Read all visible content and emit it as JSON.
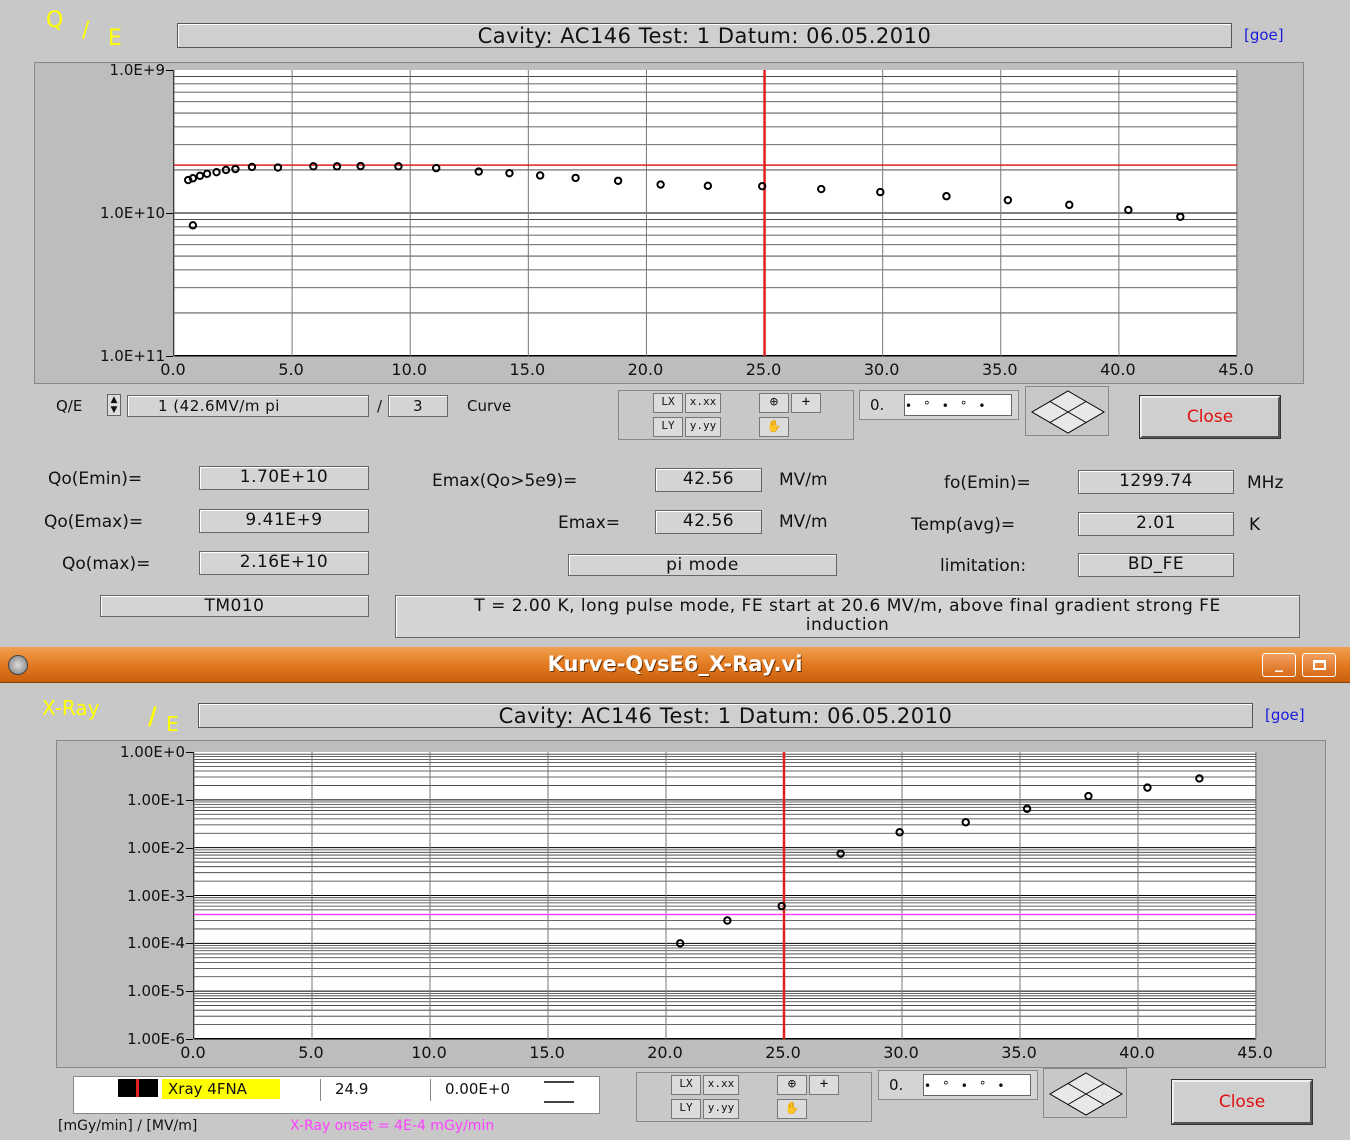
{
  "top_panel": {
    "logo_q": "Q",
    "logo_slash": "/",
    "logo_e": "E",
    "header": "Cavity: AC146   Test: 1   Datum: 06.05.2010",
    "goe": "[goe]",
    "curve_label": "Q/E",
    "curve_value": "1  (42.6MV/m pi",
    "curve_sep": "/",
    "curve_count": "3",
    "curve_word": "Curve",
    "cursor_display_prefix": "0.",
    "close_label": "Close",
    "fields": {
      "qo_emin_label": "Qo(Emin)=",
      "qo_emin_value": "1.70E+10",
      "qo_emax_label": "Qo(Emax)=",
      "qo_emax_value": "9.41E+9",
      "qo_max_label": "Qo(max)=",
      "qo_max_value": "2.16E+10",
      "emax_qo_label": "Emax(Qo>5e9)=",
      "emax_qo_value": "42.56",
      "emax_qo_unit": "MV/m",
      "emax_label": "Emax=",
      "emax_value": "42.56",
      "emax_unit": "MV/m",
      "mode": "pi mode",
      "fo_label": "fo(Emin)=",
      "fo_value": "1299.74",
      "fo_unit": "MHz",
      "temp_label": "Temp(avg)=",
      "temp_value": "2.01",
      "temp_unit": "K",
      "limit_label": "limitation:",
      "limit_value": "BD_FE",
      "tm_mode": "TM010",
      "comment": "T = 2.00 K, long pulse mode, FE start at 20.6 MV/m, above final gradient strong FE induction"
    }
  },
  "window": {
    "title": "Kurve-QvsE6_X-Ray.vi",
    "minimize_label": "_"
  },
  "bottom_panel": {
    "logo_xray": "X-Ray",
    "logo_slash": "/",
    "logo_e": "E",
    "header": "Cavity: AC146   Test: 1   Datum: 06.05.2010",
    "goe": "[goe]",
    "legend_name": "Xray 4FNA",
    "legend_val1": "24.9",
    "legend_val2": "0.00E+0",
    "units_label": "[mGy/min] / [MV/m]",
    "onset_label": "X-Ray onset = 4E-4 mGy/min",
    "cursor_display_prefix": "0.",
    "close_label": "Close"
  },
  "colors": {
    "logo_yellow": "#ffff00",
    "cursor_red": "#e02020",
    "onset_magenta": "#ff40ff",
    "close_text": "#e01010",
    "goe_blue": "#1a1ae0",
    "titlebar_orange": "#e37a20"
  },
  "chart_data": [
    {
      "type": "scatter",
      "title": "",
      "log_y": true,
      "xlim": [
        0,
        45
      ],
      "ylim": [
        1000000000.0,
        100000000000.0
      ],
      "xticks": [
        "0.0",
        "5.0",
        "10.0",
        "15.0",
        "20.0",
        "25.0",
        "30.0",
        "35.0",
        "40.0",
        "45.0"
      ],
      "yticks": [
        "1.0E+9",
        "1.0E+10",
        "1.0E+11"
      ],
      "cursor_x": 25.0,
      "cursor_y": 21600000000.0,
      "series": [
        {
          "x": [
            0.6,
            0.8,
            1.1,
            1.4,
            1.8,
            2.2,
            2.6,
            3.3,
            4.4,
            5.9,
            6.9,
            7.9,
            9.5,
            11.1,
            12.9,
            14.2,
            15.5,
            17.0,
            18.8,
            20.6,
            22.6,
            24.9,
            27.4,
            29.9,
            32.7,
            35.3,
            37.9,
            40.4,
            42.6
          ],
          "y": [
            17000000000.0,
            17500000000.0,
            18200000000.0,
            18800000000.0,
            19300000000.0,
            20000000000.0,
            20300000000.0,
            21000000000.0,
            20800000000.0,
            21200000000.0,
            21200000000.0,
            21300000000.0,
            21200000000.0,
            20600000000.0,
            19500000000.0,
            19000000000.0,
            18300000000.0,
            17600000000.0,
            16800000000.0,
            15800000000.0,
            15500000000.0,
            15400000000.0,
            14700000000.0,
            14000000000.0,
            13100000000.0,
            12300000000.0,
            11400000000.0,
            10500000000.0,
            9410000000.0
          ]
        },
        {
          "x": [
            0.8
          ],
          "y": [
            8200000000.0
          ]
        }
      ]
    },
    {
      "type": "scatter",
      "title": "",
      "log_y": true,
      "xlim": [
        0,
        45
      ],
      "ylim": [
        1e-06,
        1
      ],
      "xticks": [
        "0.0",
        "5.0",
        "10.0",
        "15.0",
        "20.0",
        "25.0",
        "30.0",
        "35.0",
        "40.0",
        "45.0"
      ],
      "yticks": [
        "1.00E+0",
        "1.00E-1",
        "1.00E-2",
        "1.00E-3",
        "1.00E-4",
        "1.00E-5",
        "1.00E-6"
      ],
      "cursor_x": 25.0,
      "onset_y": 0.0004,
      "series": [
        {
          "name": "Xray 4FNA",
          "x": [
            20.6,
            22.6,
            24.9,
            27.4,
            29.9,
            32.7,
            35.3,
            37.9,
            40.4,
            42.6
          ],
          "y": [
            0.0001,
            0.0003,
            0.0006,
            0.0075,
            0.021,
            0.034,
            0.065,
            0.12,
            0.18,
            0.28
          ]
        }
      ]
    }
  ]
}
